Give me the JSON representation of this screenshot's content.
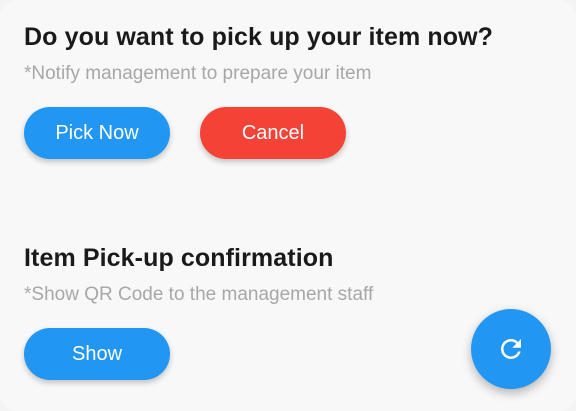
{
  "pickup": {
    "title": "Do you want to pick up your item now?",
    "subtitle": "*Notify management to prepare your item",
    "pick_now_label": "Pick Now",
    "cancel_label": "Cancel"
  },
  "confirmation": {
    "title": "Item Pick-up confirmation",
    "subtitle": "*Show QR Code to the management staff",
    "show_label": "Show"
  },
  "fab": {
    "icon": "refresh-icon"
  },
  "colors": {
    "primary": "#2196f3",
    "danger": "#f44336",
    "title_text": "#1a1a1a",
    "subtitle_text": "#a7a7a7",
    "background": "#f8f8f8"
  }
}
